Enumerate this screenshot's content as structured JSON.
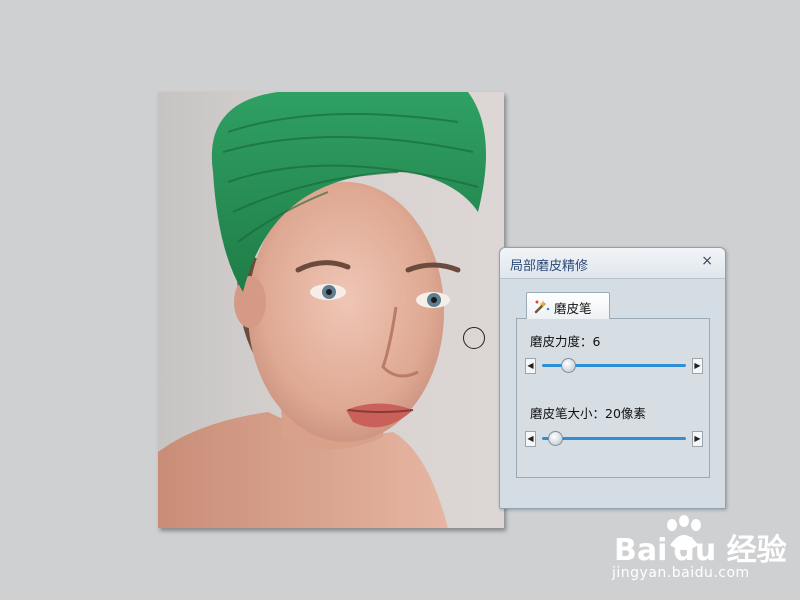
{
  "dialog": {
    "title": "局部磨皮精修",
    "close_label": "×",
    "tab_label": "磨皮笔",
    "fields": [
      {
        "label": "磨皮力度：6",
        "value": 6
      },
      {
        "label": "磨皮笔大小：20像素",
        "value": 20
      }
    ]
  },
  "watermark": {
    "brand": "Bai du 经验",
    "url": "jingyan.baidu.com"
  },
  "icons": {
    "tab": "brush-wand-icon",
    "close": "close-icon",
    "slider_left": "arrow-left-icon",
    "slider_right": "arrow-right-icon"
  },
  "colors": {
    "title_text": "#2c4a7a",
    "slider_track": "#2f8fd6",
    "headwrap": "#2f9a5c"
  }
}
